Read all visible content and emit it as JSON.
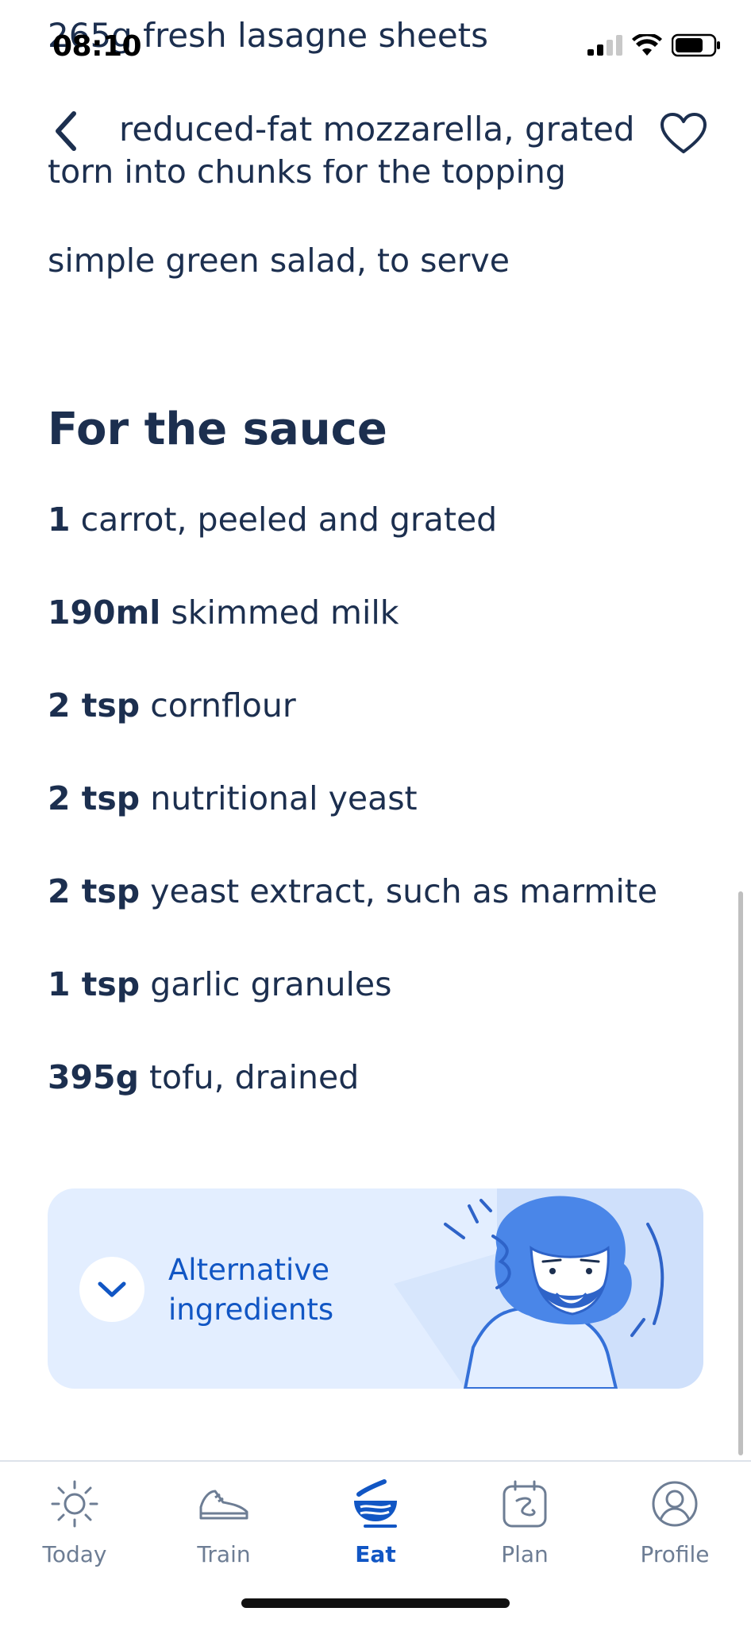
{
  "status_bar": {
    "time": "08:10"
  },
  "header": {
    "partial_above": "265g fresh lasagne sheets",
    "title": "reduced-fat mozzarella, grated or"
  },
  "ingredients": {
    "partial_line": "torn into chunks for the topping",
    "line_salad": "simple green salad, to serve"
  },
  "sauce": {
    "heading": "For the sauce",
    "items": [
      {
        "qty": "1",
        "text": "carrot, peeled and grated"
      },
      {
        "qty": "190ml",
        "text": "skimmed milk"
      },
      {
        "qty": "2 tsp",
        "text": "cornflour"
      },
      {
        "qty": "2 tsp",
        "text": "nutritional yeast"
      },
      {
        "qty": "2 tsp",
        "text": "yeast extract, such as marmite"
      },
      {
        "qty": "1 tsp",
        "text": "garlic granules"
      },
      {
        "qty": "395g",
        "text": "tofu, drained"
      }
    ]
  },
  "alternative_card": {
    "label": "Alternative ingredients"
  },
  "tabbar": {
    "tabs": [
      {
        "label": "Today",
        "icon": "sun-icon"
      },
      {
        "label": "Train",
        "icon": "sneaker-icon"
      },
      {
        "label": "Eat",
        "icon": "bowl-icon",
        "active": true
      },
      {
        "label": "Plan",
        "icon": "calendar-icon"
      },
      {
        "label": "Profile",
        "icon": "profile-icon"
      }
    ]
  },
  "colors": {
    "text": "#1c2f4f",
    "accent": "#1156c4",
    "card": "#e3eeff",
    "tab_inactive": "#6d7d94"
  }
}
